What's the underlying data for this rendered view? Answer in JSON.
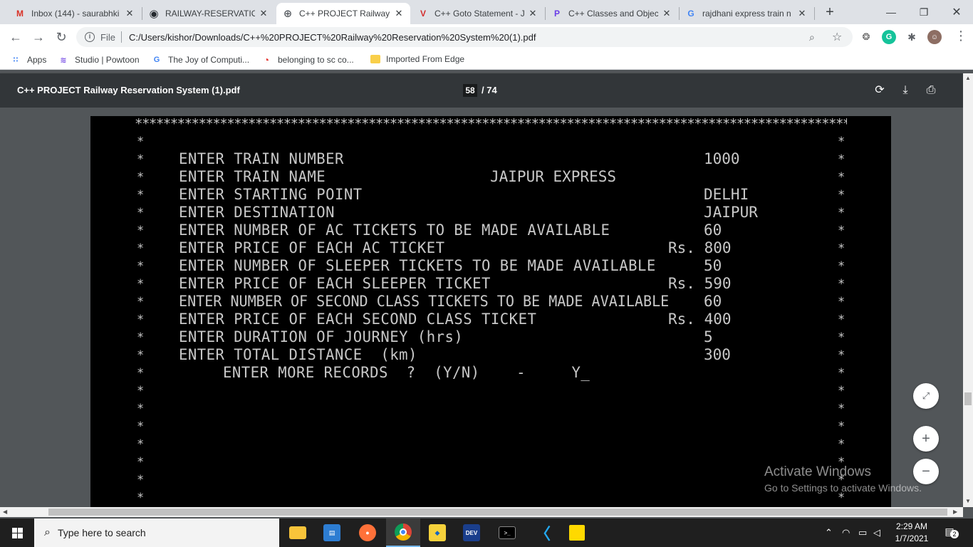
{
  "browser": {
    "tabs": [
      {
        "title": "Inbox (144) - saurabhki",
        "fav_icon": "gmail-icon",
        "fav_text": "M",
        "fav_color": "#d93025",
        "active": false
      },
      {
        "title": "RAILWAY-RESERVATION",
        "fav_icon": "github-icon",
        "fav_text": "◉",
        "fav_color": "#24292e",
        "active": false
      },
      {
        "title": "C++ PROJECT Railway R",
        "fav_icon": "globe-icon",
        "fav_text": "⊕",
        "fav_color": "#5f6368",
        "active": true
      },
      {
        "title": "C++ Goto Statement - J",
        "fav_icon": "vivaldi-icon",
        "fav_text": "V",
        "fav_color": "#d32f2f",
        "active": false
      },
      {
        "title": "C++ Classes and Object",
        "fav_icon": "p-icon",
        "fav_text": "P",
        "fav_color": "#6a3de8",
        "active": false
      },
      {
        "title": "rajdhani express train n",
        "fav_icon": "google-icon",
        "fav_text": "G",
        "fav_color": "#4285f4",
        "active": false
      }
    ],
    "new_tab_symbol": "+",
    "close_symbol": "✕",
    "address": {
      "scheme": "File",
      "url": "C:/Users/kishor/Downloads/C++%20PROJECT%20Railway%20Reservation%20System%20(1).pdf"
    },
    "bookmarks": [
      {
        "label": "Apps",
        "icon": "apps-grid-icon",
        "icon_text": "⋮⋮",
        "color": "#4285f4"
      },
      {
        "label": "Studio | Powtoon",
        "icon": "powtoon-icon",
        "icon_text": "≶",
        "color": "#7b52e6"
      },
      {
        "label": "The Joy of Computi...",
        "icon": "google-icon",
        "icon_text": "G",
        "color": "#4285f4"
      },
      {
        "label": "belonging to sc co...",
        "icon": "chrome-icon",
        "icon_text": "◔",
        "color": "#e53935"
      },
      {
        "label": "Imported From Edge",
        "icon": "folder-icon",
        "icon_text": "▬",
        "color": "#f9cf4a"
      }
    ]
  },
  "pdf": {
    "title": "C++ PROJECT Railway Reservation System (1).pdf",
    "current_page": "58",
    "total_pages": "/ 74"
  },
  "console": {
    "border_row": "******************************************************************************************************",
    "lines": [
      {
        "label": "ENTER TRAIN NUMBER",
        "value": "1000",
        "value_x": 861
      },
      {
        "label": "ENTER TRAIN NAME",
        "value": "JAIPUR EXPRESS",
        "value_x": 561
      },
      {
        "label": "ENTER STARTING POINT",
        "value": "DELHI",
        "value_x": 861
      },
      {
        "label": "ENTER DESTINATION",
        "value": "JAIPUR",
        "value_x": 861
      },
      {
        "label": "ENTER NUMBER OF AC TICKETS TO BE MADE AVAILABLE",
        "value": "60",
        "value_x": 861
      },
      {
        "label": "ENTER PRICE OF EACH AC TICKET",
        "value": "Rs. 800",
        "value_x": 811
      },
      {
        "label": "ENTER NUMBER OF SLEEPER TICKETS TO BE MADE AVAILABLE",
        "value": "50",
        "value_x": 861
      },
      {
        "label": "ENTER PRICE OF EACH SLEEPER TICKET",
        "value": "Rs. 590",
        "value_x": 811
      },
      {
        "label": "ENTER NUMBER OF SECOND CLASS TICKETS TO BE MADE AVAILABLE",
        "value": "60",
        "value_x": 861
      },
      {
        "label": "ENTER PRICE OF EACH SECOND CLASS TICKET",
        "value": "Rs. 400",
        "value_x": 811
      },
      {
        "label": "ENTER DURATION OF JOURNEY (hrs)",
        "value": "5",
        "value_x": 861
      },
      {
        "label": "ENTER TOTAL DISTANCE  (km)",
        "value": "300",
        "value_x": 861
      }
    ],
    "prompt": "ENTER MORE RECORDS  ?  (Y/N)    -     Y_",
    "side_star": "*"
  },
  "watermark": {
    "line1": "Activate Windows",
    "line2": "Go to Settings to activate Windows."
  },
  "taskbar": {
    "search_placeholder": "Type here to search",
    "time": "2:29 AM",
    "date": "1/7/2021",
    "notifications": "2"
  }
}
